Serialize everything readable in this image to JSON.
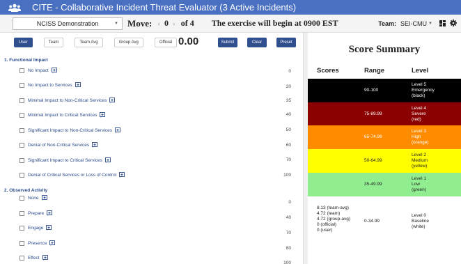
{
  "app": {
    "title": "CITE - Collaborative Incident Threat Evaluator (3 Active Incidents)"
  },
  "controls": {
    "exercise": "NCISS Demonstration",
    "move_label": "Move:",
    "move_prev": "‹",
    "move_current": "0",
    "move_next": "›",
    "move_of": "of 4",
    "message": "The exercise will begin at 0900 EST",
    "team_label": "Team:",
    "team_value": "SEI-CMU"
  },
  "toolbar": {
    "modes": [
      "User",
      "Team",
      "Team Avg",
      "Group Avg",
      "Official"
    ],
    "score": "0.00",
    "submit": "Submit",
    "clear": "Clear",
    "preset": "Preset"
  },
  "sections": [
    {
      "title": "1. Functional Impact",
      "options": [
        {
          "label": "No Impact",
          "value": "0"
        },
        {
          "label": "No Impact to Services",
          "value": "20"
        },
        {
          "label": "Minimal Impact to Non-Critical Services",
          "value": "35"
        },
        {
          "label": "Minimal Impact to Critical Services",
          "value": "40"
        },
        {
          "label": "Significant Impact to Non-Critical Services",
          "value": "50"
        },
        {
          "label": "Denial of Non-Critical Services",
          "value": "60"
        },
        {
          "label": "Significant Impact to Critical Services",
          "value": "70"
        },
        {
          "label": "Denial of Critical Services or Loss of Control",
          "value": "100"
        }
      ]
    },
    {
      "title": "2. Observed Activity",
      "options": [
        {
          "label": "None",
          "value": "0"
        },
        {
          "label": "Prepare",
          "value": "40"
        },
        {
          "label": "Engage",
          "value": "70"
        },
        {
          "label": "Presence",
          "value": "80"
        },
        {
          "label": "Effect",
          "value": "100"
        }
      ]
    }
  ],
  "summary": {
    "title": "Score Summary",
    "headers": {
      "scores": "Scores",
      "range": "Range",
      "level": "Level"
    },
    "bands": [
      {
        "range": "90-100",
        "level": [
          "Level 5",
          "Emergency",
          "(black)"
        ],
        "bg": "#000000",
        "fg": "#ffffff"
      },
      {
        "range": "75-89.99",
        "level": [
          "Level 4",
          "Severe",
          "(red)"
        ],
        "bg": "#8b0000",
        "fg": "#ffffff"
      },
      {
        "range": "65-74.99",
        "level": [
          "Level 3",
          "High",
          "(orange)"
        ],
        "bg": "#ff8c00",
        "fg": "#ffffff"
      },
      {
        "range": "50-64.99",
        "level": [
          "Level 2",
          "Medium",
          "(yellow)"
        ],
        "bg": "#ffff00",
        "fg": "#222222"
      },
      {
        "range": "35-49.99",
        "level": [
          "Level 1",
          "Low",
          "(green)"
        ],
        "bg": "#90ee90",
        "fg": "#222222"
      },
      {
        "range": "0-34.99",
        "level": [
          "Level 0",
          "Baseline",
          "(white)"
        ],
        "bg": "#ffffff",
        "fg": "#222222",
        "scores": [
          "8.13 (team-avg)",
          "4.72 (team)",
          "4.72 (group-avg)",
          "0 (official)",
          "0 (user)"
        ]
      }
    ]
  },
  "colors": {
    "titlebar": "#4a70c2",
    "primary_button": "#2f4f8f",
    "section_text": "#2a4a8a"
  }
}
